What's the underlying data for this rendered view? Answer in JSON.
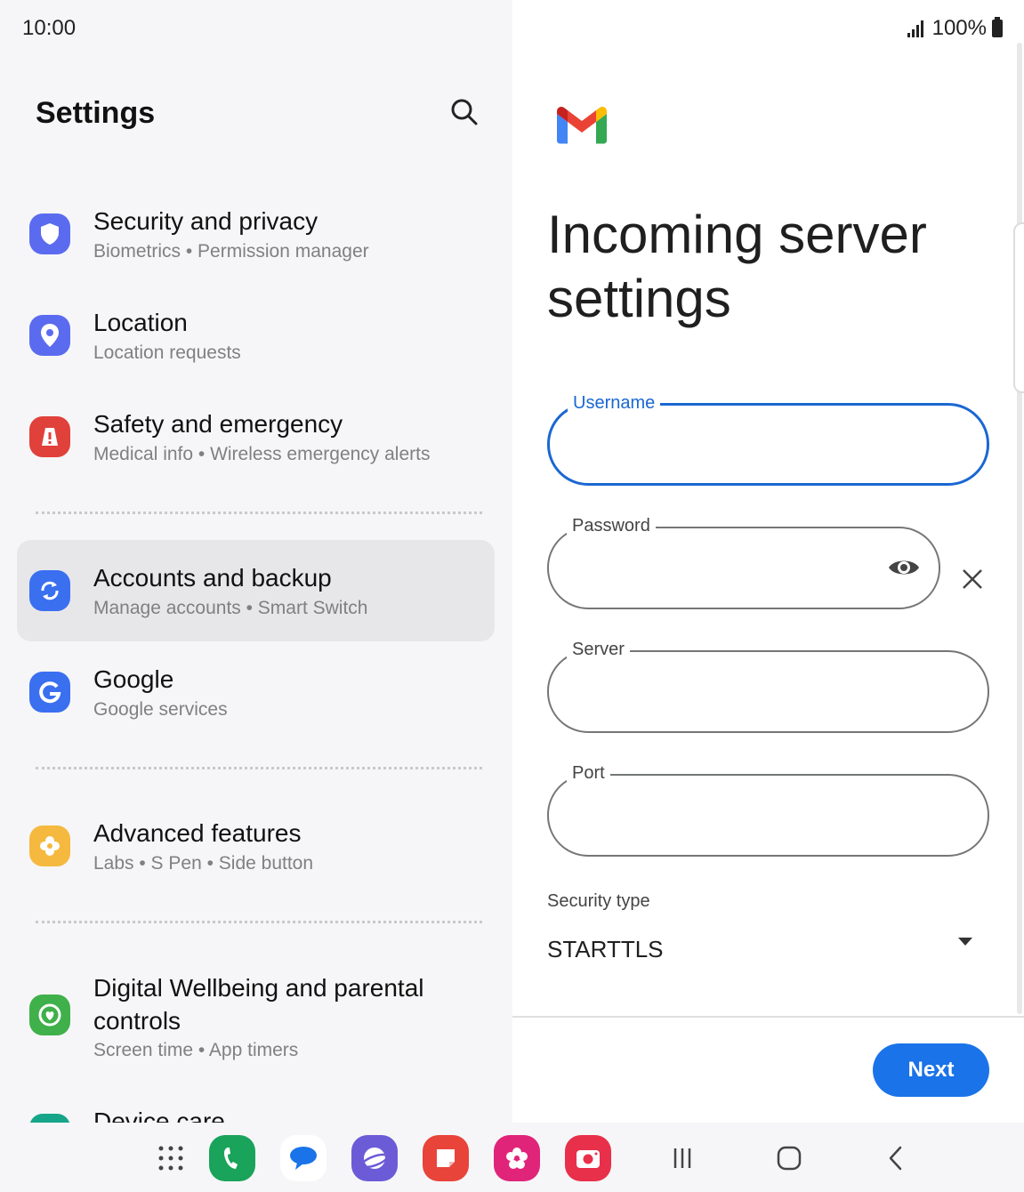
{
  "status_bar": {
    "time": "10:00",
    "battery": "100%"
  },
  "left": {
    "title": "Settings",
    "items": [
      {
        "title": "Security and privacy",
        "subtitle": "Biometrics  •  Permission manager",
        "icon": "shield-icon",
        "color": "#5b6bf0"
      },
      {
        "title": "Location",
        "subtitle": "Location requests",
        "icon": "location-pin-icon",
        "color": "#5b6bf0"
      },
      {
        "title": "Safety and emergency",
        "subtitle": "Medical info  •  Wireless emergency alerts",
        "icon": "emergency-icon",
        "color": "#e0413a"
      },
      {
        "title": "Accounts and backup",
        "subtitle": "Manage accounts  •  Smart Switch",
        "icon": "sync-icon",
        "color": "#3a6ff0"
      },
      {
        "title": "Google",
        "subtitle": "Google services",
        "icon": "google-g-icon",
        "color": "#3a6ff0"
      },
      {
        "title": "Advanced features",
        "subtitle": "Labs  •  S Pen  •  Side button",
        "icon": "flower-gear-icon",
        "color": "#f5b93f"
      },
      {
        "title": "Digital Wellbeing and parental controls",
        "subtitle": "Screen time  •  App timers",
        "icon": "wellbeing-icon",
        "color": "#3fb04a"
      },
      {
        "title": "Device care",
        "subtitle": "",
        "icon": "device-care-icon",
        "color": "#17a589"
      }
    ]
  },
  "right": {
    "heading": "Incoming server settings",
    "fields": {
      "username": {
        "label": "Username",
        "value": ""
      },
      "password": {
        "label": "Password",
        "value": ""
      },
      "server": {
        "label": "Server",
        "value": ""
      },
      "port": {
        "label": "Port",
        "value": ""
      }
    },
    "security": {
      "label": "Security type",
      "value": "STARTTLS"
    },
    "next_label": "Next"
  },
  "dock": [
    "apps-grid-icon",
    "phone-icon",
    "messages-icon",
    "internet-icon",
    "notes-icon",
    "gallery-icon",
    "camera-icon"
  ],
  "nav": [
    "recents-icon",
    "home-icon",
    "back-icon"
  ]
}
